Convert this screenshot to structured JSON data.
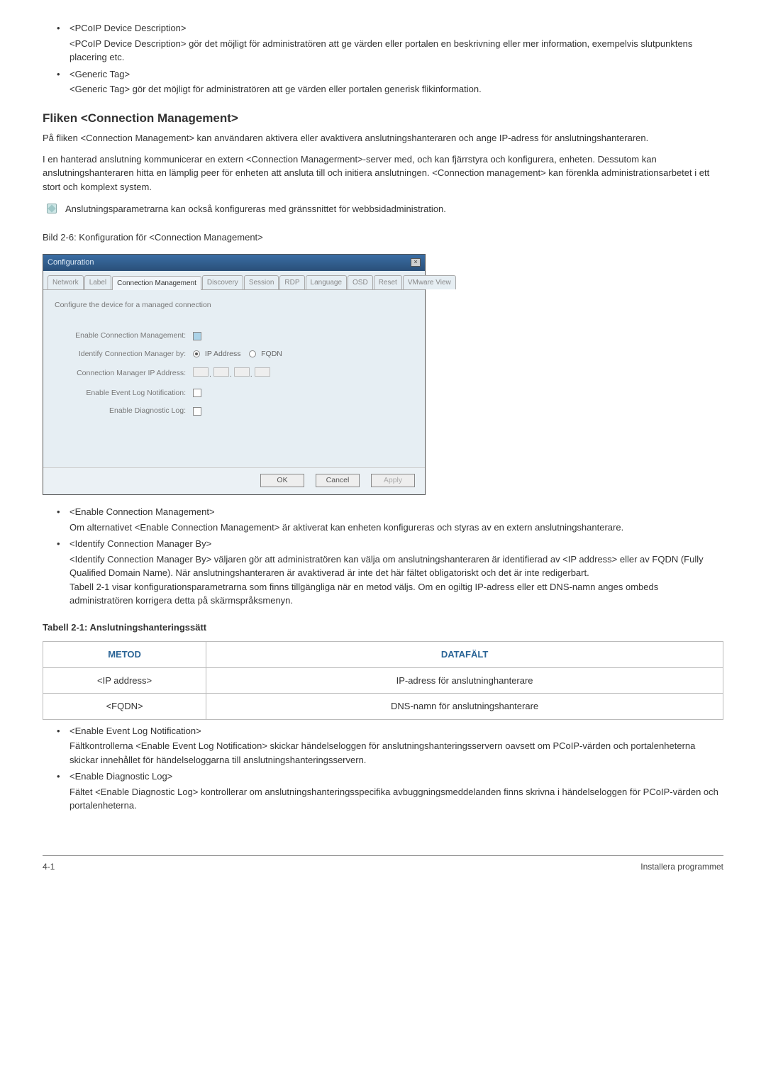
{
  "top_items": [
    {
      "title": "<PCoIP Device Description>",
      "desc": "<PCoIP Device Description> gör det möjligt för administratören att ge värden eller portalen en beskrivning eller mer information, exempelvis slutpunktens placering etc."
    },
    {
      "title": "<Generic Tag>",
      "desc": "<Generic Tag> gör det möjligt för administratören att ge värden eller portalen generisk flikinformation."
    }
  ],
  "section_heading": "Fliken <Connection Management>",
  "section_para1": "På fliken <Connection Management> kan användaren aktivera eller avaktivera anslutningshanteraren och ange IP-adress för anslutningshanteraren.",
  "section_para2": "I en hanterad anslutning kommunicerar en extern <Connection Managerment>-server med, och kan fjärrstyra och konfigurera, enheten. Dessutom kan anslutningshanteraren hitta en lämplig peer för enheten att ansluta till och initiera anslutningen. <Connection management> kan förenkla administrationsarbetet i ett stort och komplext system.",
  "note_text": "Anslutningsparametrarna kan också konfigureras med gränssnittet för webbsidadministration.",
  "figure_caption": "Bild 2-6: Konfiguration för <Connection Management>",
  "dialog": {
    "title": "Configuration",
    "tabs": [
      "Network",
      "Label",
      "Connection Management",
      "Discovery",
      "Session",
      "RDP",
      "Language",
      "OSD",
      "Reset",
      "VMware View"
    ],
    "active_tab": "Connection Management",
    "description": "Configure the device for a managed connection",
    "labels": {
      "enable_cm": "Enable Connection Management:",
      "identify_by": "Identify Connection Manager by:",
      "cm_ip": "Connection Manager IP Address:",
      "event_log": "Enable Event Log Notification:",
      "diag_log": "Enable Diagnostic Log:"
    },
    "radio_ip": "IP Address",
    "radio_fqdn": "FQDN",
    "buttons": {
      "ok": "OK",
      "cancel": "Cancel",
      "apply": "Apply"
    }
  },
  "lower_items": [
    {
      "title": "<Enable Connection Management>",
      "desc": "Om alternativet <Enable Connection Management> är aktiverat kan enheten konfigureras och styras av en extern anslutningshanterare."
    },
    {
      "title": "<Identify Connection Manager By>",
      "desc": "<Identify Connection Manager By> väljaren gör att administratören kan välja om anslutningshanteraren är identifierad av <IP address> eller av FQDN (Fully Qualified Domain Name). När anslutningshanteraren är avaktiverad är inte det här fältet obligatoriskt och det är inte redigerbart.\nTabell 2-1 visar konfigurationsparametrarna som finns tillgängliga när en metod väljs. Om en ogiltig IP-adress eller ett DNS-namn anges ombeds administratören korrigera detta på skärmspråksmenyn."
    }
  ],
  "table_caption": "Tabell 2-1: Anslutningshanteringssätt",
  "table": {
    "headers": [
      "METOD",
      "DATAFÄLT"
    ],
    "rows": [
      [
        "<IP address>",
        "IP-adress för anslutninghanterare"
      ],
      [
        "<FQDN>",
        "DNS-namn för anslutningshanterare"
      ]
    ]
  },
  "bottom_items": [
    {
      "title": "<Enable Event Log Notification>",
      "desc": "Fältkontrollerna <Enable Event Log Notification> skickar händelseloggen för anslutningshanteringsservern oavsett om PCoIP-värden och portalenheterna skickar innehållet för händelseloggarna till anslutningshanteringsservern."
    },
    {
      "title": "<Enable Diagnostic Log>",
      "desc": "Fältet <Enable Diagnostic Log> kontrollerar om anslutningshanteringsspecifika avbuggningsmeddelanden finns skrivna i händelseloggen för PCoIP-värden och portalenheterna."
    }
  ],
  "footer": {
    "left": "4-1",
    "right": "Installera programmet"
  }
}
